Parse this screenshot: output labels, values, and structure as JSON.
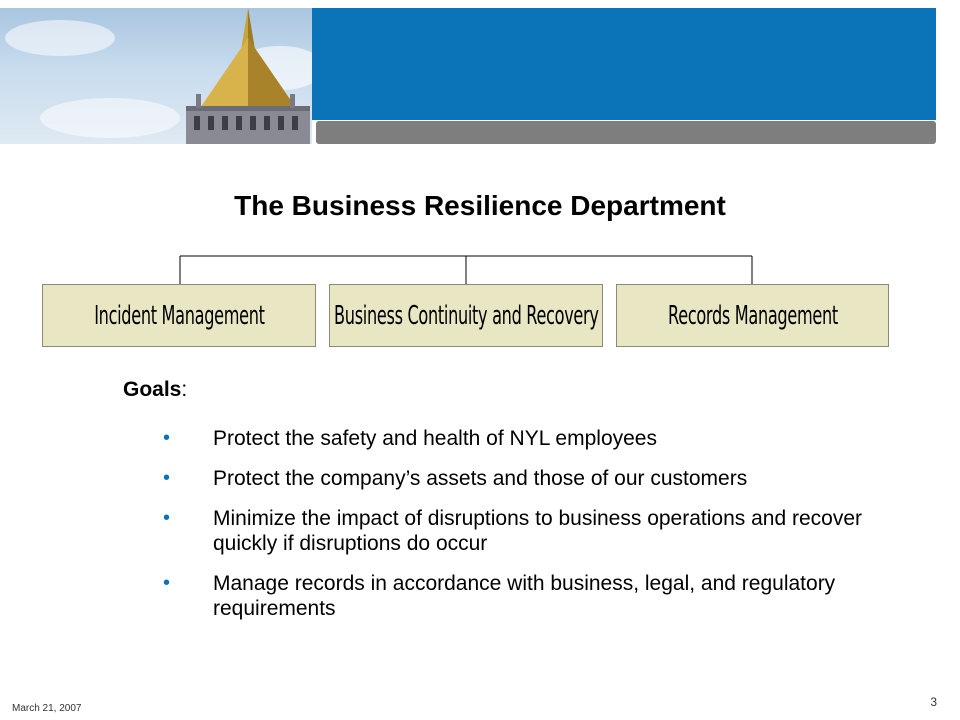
{
  "header": {
    "photo_icon": "building-tower-photo",
    "blue_color": "#0b74b9",
    "grey_color": "#7e7e7e"
  },
  "slide": {
    "title": "The Business Resilience Department"
  },
  "org_chart": {
    "boxes": [
      {
        "label": "Incident Management"
      },
      {
        "label": "Business Continuity and Recovery"
      },
      {
        "label": "Records Management"
      }
    ],
    "box_color": "#e9e6c3"
  },
  "goals": {
    "title": "Goals",
    "title_suffix": ":",
    "bullet": "•",
    "items": [
      "Protect the safety and health of NYL employees",
      "Protect the company’s assets and those of our customers",
      "Minimize the impact of disruptions to business operations and recover quickly if disruptions do occur",
      "Manage records in accordance with business, legal, and regulatory requirements"
    ]
  },
  "footer": {
    "date": "March 21, 2007",
    "page_number": "3"
  }
}
